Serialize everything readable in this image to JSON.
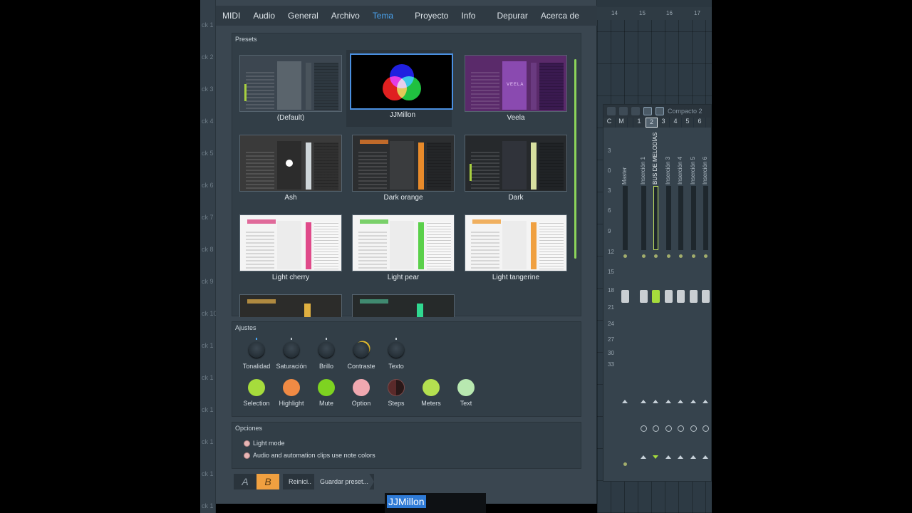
{
  "tabs": [
    "MIDI",
    "Audio",
    "General",
    "Archivo",
    "Tema",
    "Proyecto",
    "Info",
    "Depurar",
    "Acerca de"
  ],
  "active_tab": "Tema",
  "presets": {
    "title": "Presets",
    "items": [
      {
        "label": "(Default)",
        "accent": "#a8d040"
      },
      {
        "label": "JJMillon",
        "selected": true
      },
      {
        "label": "Veela",
        "accent": "#b050c8"
      },
      {
        "label": "Ash",
        "accent": "#cfd6da"
      },
      {
        "label": "Dark orange",
        "accent": "#e88a2a"
      },
      {
        "label": "Dark",
        "accent": "#d8e0a0"
      },
      {
        "label": "Light cherry",
        "accent": "#e04a8a"
      },
      {
        "label": "Light pear",
        "accent": "#5ad04a"
      },
      {
        "label": "Light tangerine",
        "accent": "#f0a040"
      }
    ],
    "veela_logo": "VEELA"
  },
  "ajustes": {
    "title": "Ajustes",
    "knobs": [
      "Tonalidad",
      "Saturación",
      "Brillo",
      "Contraste",
      "Texto"
    ],
    "swatches": [
      {
        "label": "Selection",
        "color": "#a6dc3c"
      },
      {
        "label": "Highlight",
        "color": "#f08a44"
      },
      {
        "label": "Mute",
        "color": "#7ed321"
      },
      {
        "label": "Option",
        "color": "#f0a8b0"
      },
      {
        "label": "Steps",
        "color": "#4a2a2a"
      },
      {
        "label": "Meters",
        "color": "#b4e050"
      },
      {
        "label": "Text",
        "color": "#b8e8b0"
      }
    ]
  },
  "opciones": {
    "title": "Opciones",
    "items": [
      "Light mode",
      "Audio and automation clips use note colors"
    ]
  },
  "bottom": {
    "a_label": "A",
    "b_label": "B",
    "reset_label": "Reinici..",
    "save_label": "Guardar preset..."
  },
  "rename_value": "JJMillon",
  "mixer": {
    "preset_name": "Compacto 2",
    "headers": [
      "C",
      "M",
      "1",
      "2",
      "3",
      "4",
      "5",
      "6"
    ],
    "tracks": [
      "Master",
      "Inserción 1",
      "BUS DE MELODÍAS",
      "Inserción 3",
      "Inserción 4",
      "Inserción 5",
      "Inserción 6"
    ],
    "db_scale": [
      "3",
      "0",
      "3",
      "6",
      "9",
      "12",
      "15",
      "18",
      "21",
      "24",
      "27",
      "30",
      "33"
    ]
  },
  "ruler": [
    "14",
    "15",
    "16",
    "17"
  ],
  "track_labels": [
    "ck 1",
    "ck 2",
    "ck 3",
    "ck 4",
    "ck 5",
    "ck 6",
    "ck 7",
    "ck 8",
    "ck 9",
    "ck 10",
    "ck 1",
    "ck 1",
    "ck 1",
    "ck 1",
    "ck 1",
    "ck 1"
  ]
}
